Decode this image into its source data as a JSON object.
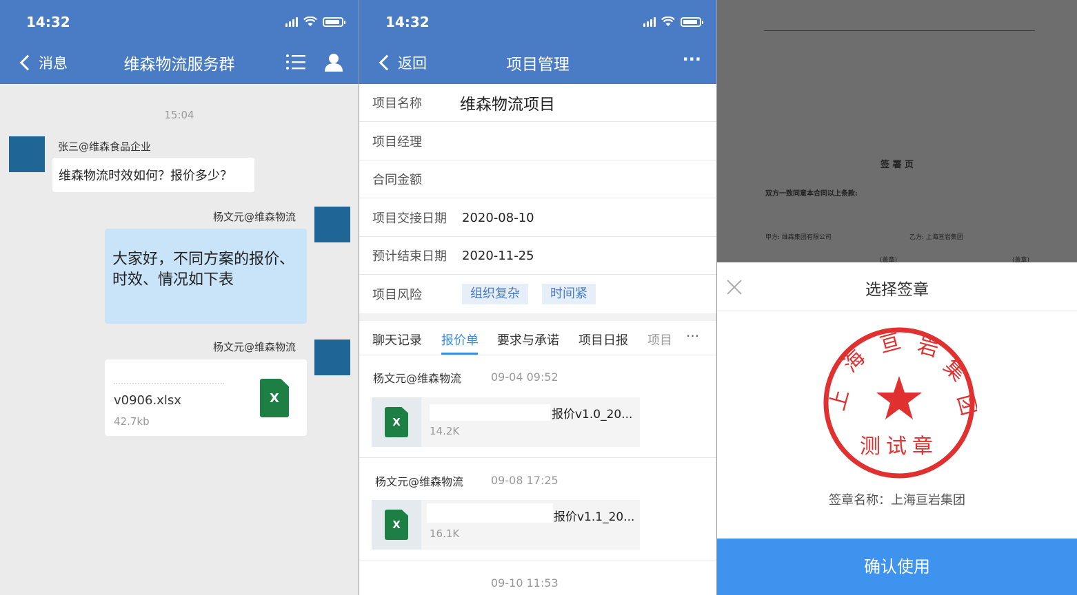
{
  "status": {
    "time": "14:32"
  },
  "chat": {
    "back_label": "消息",
    "title": "维森物流服务群",
    "time1": "15:04",
    "msg1": {
      "sender": "张三@维森食品企业",
      "text": "维森物流时效如何？报价多少？"
    },
    "msg2": {
      "sender": "杨文元@维森物流",
      "line1": "大家好，不同方案的报价、",
      "line2": "时效、情况如下表"
    },
    "msg3": {
      "sender": "杨文元@维森物流",
      "file_name": "v0906.xlsx",
      "file_size": "42.7kb",
      "icon_text": "X"
    }
  },
  "project": {
    "back_label": "返回",
    "title": "项目管理",
    "more": "···",
    "fields": [
      {
        "label": "项目名称",
        "value": "维森物流项目"
      },
      {
        "label": "项目经理",
        "value": ""
      },
      {
        "label": "合同金额",
        "value": ""
      },
      {
        "label": "项目交接日期",
        "value": "2020-08-10"
      },
      {
        "label": "预计结束日期",
        "value": "2020-11-25"
      },
      {
        "label": "项目风险",
        "value": ""
      }
    ],
    "risk_tags": [
      "组织复杂",
      "时间紧"
    ],
    "tabs": [
      "聊天记录",
      "报价单",
      "要求与承诺",
      "项目日报",
      "项目"
    ],
    "tabs_more": "···",
    "quotes": [
      {
        "sender": "杨文元@维森物流",
        "time": "09-04 09:52",
        "file_name": "报价v1.0_20...",
        "file_size": "14.2K",
        "icon_text": "X"
      },
      {
        "sender": "杨文元@维森物流",
        "time": "09-08 17:25",
        "file_name": "报价v1.1_20...",
        "file_size": "16.1K",
        "icon_text": "X"
      }
    ],
    "time3": "09-10 11:53"
  },
  "seal_panel": {
    "doc": {
      "heading": "签 署 页",
      "line1": "双方一致同意本合同以上条款:",
      "party_a": "甲方: 维森集团有限公司",
      "party_b": "乙方: 上海亘岩集团",
      "stamp_a": "(盖章)",
      "stamp_b": "(盖章)"
    },
    "title": "选择签章",
    "seal": {
      "top_text": "上海亘岩集团",
      "bottom_text": "测试章",
      "color": "#e03030"
    },
    "seal_name": "签章名称：上海亘岩集团",
    "confirm_label": "确认使用"
  }
}
